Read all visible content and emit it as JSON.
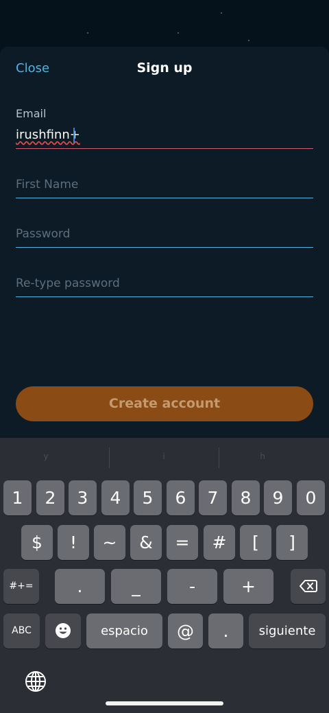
{
  "header": {
    "close_label": "Close",
    "title": "Sign up"
  },
  "form": {
    "email_label": "Email",
    "email_value": "irushfinn+",
    "first_name_placeholder": "First Name",
    "password_placeholder": "Password",
    "retype_placeholder": "Re-type password",
    "create_button": "Create account"
  },
  "colors": {
    "accent": "#4fb3e6",
    "error_line": "#d0616a",
    "button": "#8a4b14"
  },
  "keyboard": {
    "suggestions": [
      "y",
      "i",
      "h"
    ],
    "row1": [
      "1",
      "2",
      "3",
      "4",
      "5",
      "6",
      "7",
      "8",
      "9",
      "0"
    ],
    "row2": [
      "$",
      "!",
      "~",
      "&",
      "=",
      "#",
      "[",
      "]"
    ],
    "row3": {
      "toggle": "#+=",
      "keys": [
        ".",
        "_",
        "-",
        "+"
      ],
      "delete_icon": "backspace-icon"
    },
    "row4": {
      "abc": "ABC",
      "emoji_icon": "emoji-icon",
      "space": "espacio",
      "at": "@",
      "dot": ".",
      "next": "siguiente"
    },
    "globe_icon": "globe-icon"
  }
}
